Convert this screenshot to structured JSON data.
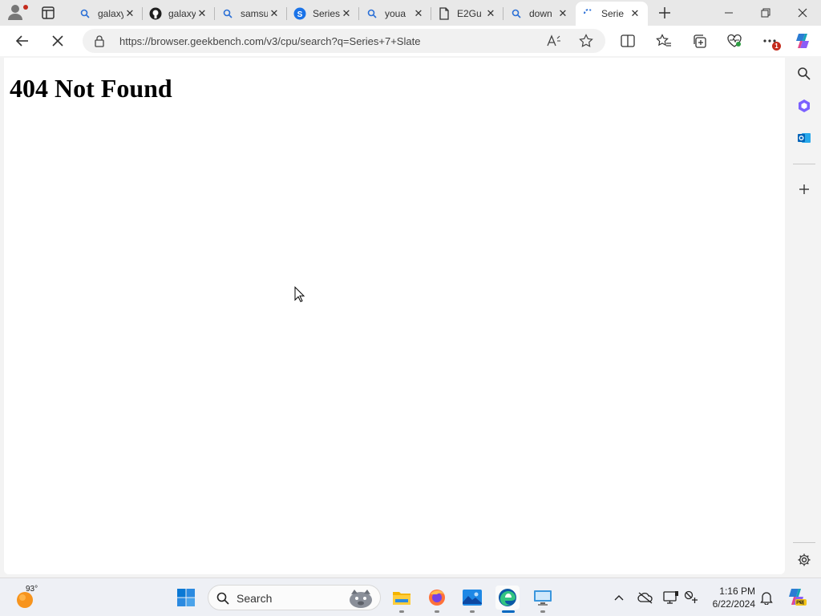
{
  "tabs": [
    {
      "label": "galaxy",
      "icon": "search-icon"
    },
    {
      "label": "galaxy",
      "icon": "github-icon"
    },
    {
      "label": "samsung",
      "icon": "search-icon"
    },
    {
      "label": "Series",
      "icon": "samsung-s-icon"
    },
    {
      "label": "youa",
      "icon": "search-icon"
    },
    {
      "label": "E2Gu",
      "icon": "document-icon"
    },
    {
      "label": "down",
      "icon": "search-icon"
    },
    {
      "label": "Serie",
      "icon": "loading-icon",
      "active": true
    }
  ],
  "address_bar": {
    "url": "https://browser.geekbench.com/v3/cpu/search?q=Series+7+Slate"
  },
  "toolbar": {
    "notification_count": "1"
  },
  "page": {
    "heading": "404 Not Found"
  },
  "taskbar": {
    "weather_temp": "93°",
    "search_placeholder": "Search",
    "apps": [
      "file-explorer-icon",
      "firefox-icon",
      "photos-icon",
      "edge-icon",
      "remote-desktop-icon"
    ],
    "clock_time": "1:16 PM",
    "clock_date": "6/22/2024"
  },
  "colors": {
    "accent": "#0067c0",
    "notification": "#c42b1c",
    "titlebar": "#e8e8e8"
  }
}
